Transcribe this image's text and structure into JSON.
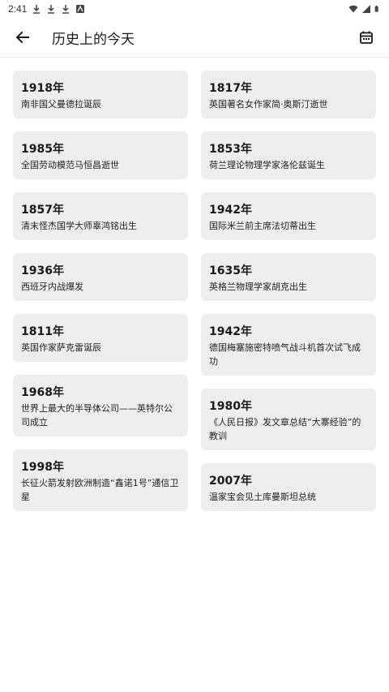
{
  "status_bar": {
    "time": "2:41"
  },
  "header": {
    "title": "历史上的今天"
  },
  "events_left": [
    {
      "year": "1918年",
      "event": "南非国父曼德拉诞辰"
    },
    {
      "year": "1985年",
      "event": "全国劳动模范马恒昌逝世"
    },
    {
      "year": "1857年",
      "event": "清末怪杰国学大师辜鸿铭出生"
    },
    {
      "year": "1936年",
      "event": "西班牙内战爆发"
    },
    {
      "year": "1811年",
      "event": "英国作家萨克雷诞辰"
    },
    {
      "year": "1968年",
      "event": "世界上最大的半导体公司——英特尔公司成立"
    },
    {
      "year": "1998年",
      "event": "长征火箭发射欧洲制造“鑫诺1号”通信卫星"
    }
  ],
  "events_right": [
    {
      "year": "1817年",
      "event": "英国著名女作家简·奥斯汀逝世"
    },
    {
      "year": "1853年",
      "event": "荷兰理论物理学家洛伦兹诞生"
    },
    {
      "year": "1942年",
      "event": "国际米兰前主席法切蒂出生"
    },
    {
      "year": "1635年",
      "event": "英格兰物理学家胡克出生"
    },
    {
      "year": "1942年",
      "event": "德国梅塞施密特喷气战斗机首次试飞成功"
    },
    {
      "year": "1980年",
      "event": "《人民日报》发文章总结“大寨经验”的教训"
    },
    {
      "year": "2007年",
      "event": "温家宝会见土库曼斯坦总统"
    }
  ]
}
